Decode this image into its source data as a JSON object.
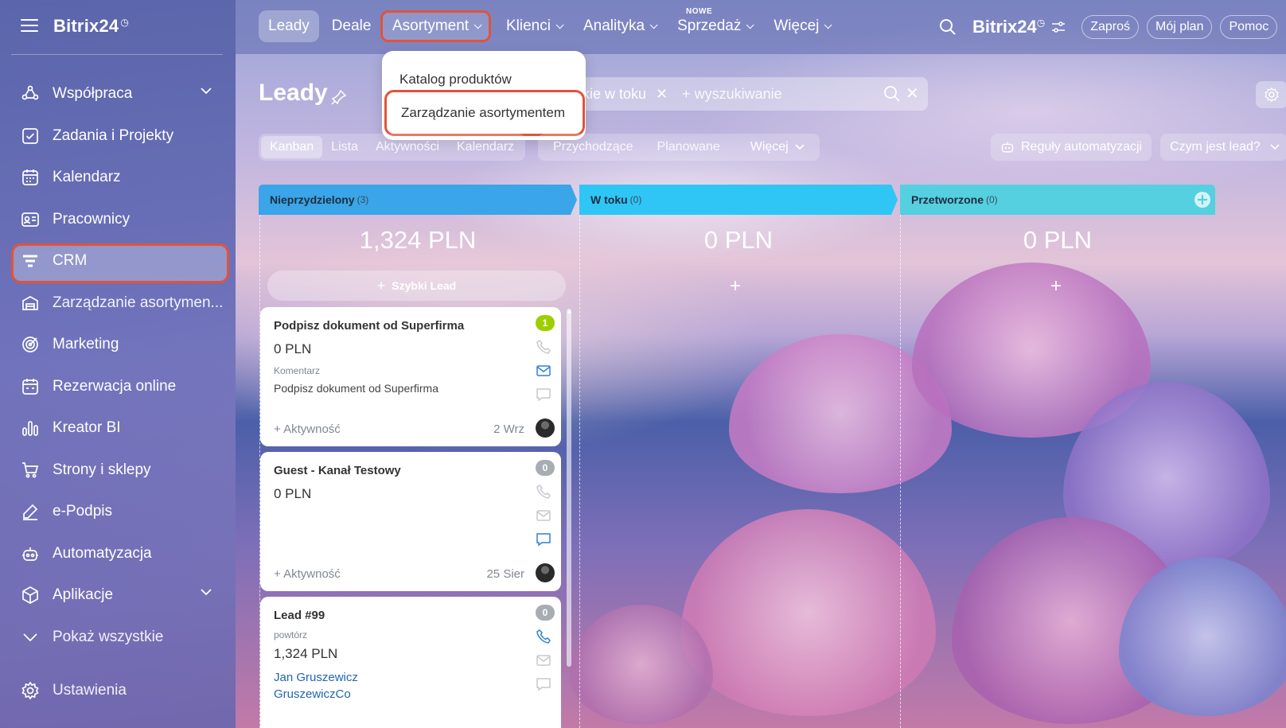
{
  "app": {
    "brand": "Bitrix24",
    "clock_mark": "◷"
  },
  "sidebar": {
    "items": [
      {
        "label": "Współpraca",
        "icon": "collaboration-icon",
        "expandable": true
      },
      {
        "label": "Zadania i Projekty",
        "icon": "tasks-icon"
      },
      {
        "label": "Kalendarz",
        "icon": "calendar-icon"
      },
      {
        "label": "Pracownicy",
        "icon": "employees-icon"
      },
      {
        "label": "CRM",
        "icon": "crm-icon",
        "active": true
      },
      {
        "label": "Zarządzanie asortymen...",
        "icon": "inventory-icon"
      },
      {
        "label": "Marketing",
        "icon": "marketing-icon"
      },
      {
        "label": "Rezerwacja online",
        "icon": "booking-icon"
      },
      {
        "label": "Kreator BI",
        "icon": "bi-chart-icon"
      },
      {
        "label": "Strony i sklepy",
        "icon": "cart-icon"
      },
      {
        "label": "e-Podpis",
        "icon": "signature-icon"
      },
      {
        "label": "Automatyzacja",
        "icon": "robot-icon"
      },
      {
        "label": "Aplikacje",
        "icon": "apps-icon",
        "expandable": true
      },
      {
        "label": "Pokaż wszystkie",
        "icon": "chevron-down-icon"
      }
    ],
    "settings": "Ustawienia"
  },
  "topnav": {
    "tabs": [
      "Leady",
      "Deale",
      "Asortyment",
      "Klienci",
      "Analityka",
      "Sprzedaż",
      "Więcej"
    ],
    "new_badge": "NOWE",
    "brand": "Bitrix24",
    "invite": "Zaproś",
    "plan": "Mój plan",
    "help": "Pomoc"
  },
  "dropdown": {
    "items": [
      "Katalog produktów",
      "Zarządzanie asortymentem"
    ]
  },
  "page": {
    "title": "Leady",
    "filter_chip": "kie w toku",
    "search_placeholder": "+ wyszukiwanie"
  },
  "views": {
    "tabs": [
      "Kanban",
      "Lista",
      "Aktywności",
      "Kalendarz"
    ],
    "tabs2": [
      "Przychodzące",
      "Planowane",
      "Więcej"
    ],
    "automation": "Reguły automatyzacji",
    "what_is": "Czym jest lead?"
  },
  "columns": [
    {
      "name": "Nieprzydzielony",
      "count": "(3)",
      "sum": "1,324 PLN",
      "color": "#3aa5e8"
    },
    {
      "name": "W toku",
      "count": "(0)",
      "sum": "0 PLN",
      "color": "#2fc6f6"
    },
    {
      "name": "Przetworzone",
      "count": "(0)",
      "sum": "0 PLN",
      "color": "#55d0e0"
    }
  ],
  "quick_lead": "Szybki Lead",
  "cards": [
    {
      "title": "Podpisz dokument od Superfirma",
      "amount": "0 PLN",
      "label": "Komentarz",
      "text": "Podpisz dokument od Superfirma",
      "activity": "+ Aktywność",
      "date": "2 Wrz",
      "badge": "1",
      "badge_color": "#9dcf00"
    },
    {
      "title": "Guest - Kanał Testowy",
      "amount": "0 PLN",
      "activity": "+ Aktywność",
      "date": "25 Sier",
      "badge": "0",
      "badge_color": "#a8adb4"
    },
    {
      "title": "Lead #99",
      "label": "powtórz",
      "amount": "1,324 PLN",
      "contact": "Jan Gruszewicz",
      "company": "GruszewiczCo",
      "badge": "0",
      "badge_color": "#a8adb4"
    }
  ]
}
